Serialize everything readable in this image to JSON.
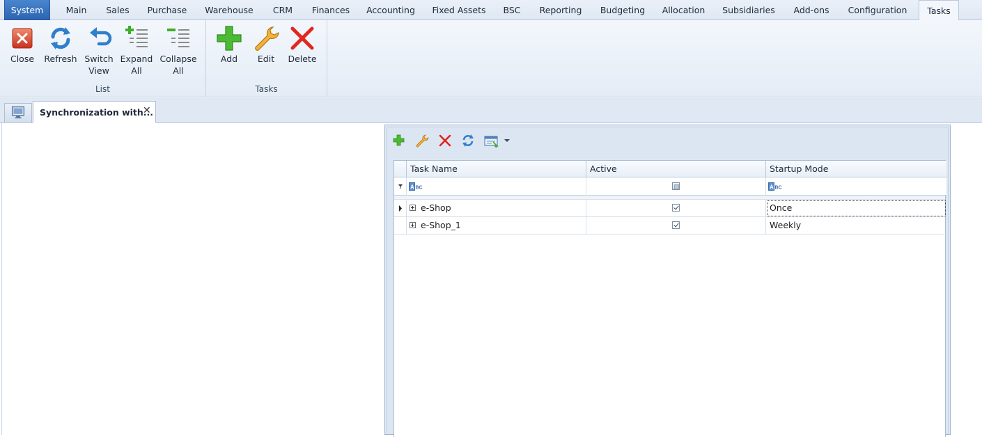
{
  "menu": {
    "tabs": [
      {
        "label": "System",
        "name": "menu-tab-system"
      },
      {
        "label": "Main",
        "name": "menu-tab-main"
      },
      {
        "label": "Sales",
        "name": "menu-tab-sales"
      },
      {
        "label": "Purchase",
        "name": "menu-tab-purchase"
      },
      {
        "label": "Warehouse",
        "name": "menu-tab-warehouse"
      },
      {
        "label": "CRM",
        "name": "menu-tab-crm"
      },
      {
        "label": "Finances",
        "name": "menu-tab-finances"
      },
      {
        "label": "Accounting",
        "name": "menu-tab-accounting"
      },
      {
        "label": "Fixed Assets",
        "name": "menu-tab-fixed-assets"
      },
      {
        "label": "BSC",
        "name": "menu-tab-bsc"
      },
      {
        "label": "Reporting",
        "name": "menu-tab-reporting"
      },
      {
        "label": "Budgeting",
        "name": "menu-tab-budgeting"
      },
      {
        "label": "Allocation",
        "name": "menu-tab-allocation"
      },
      {
        "label": "Subsidiaries",
        "name": "menu-tab-subsidiaries"
      },
      {
        "label": "Add-ons",
        "name": "menu-tab-add-ons"
      },
      {
        "label": "Configuration",
        "name": "menu-tab-configuration"
      },
      {
        "label": "Tasks",
        "name": "menu-tab-tasks"
      }
    ],
    "active_tab": "Tasks"
  },
  "ribbon": {
    "list_group": {
      "label": "List",
      "close": "Close",
      "refresh": "Refresh",
      "switch_view_1": "Switch",
      "switch_view_2": "View",
      "expand_all_1": "Expand",
      "expand_all_2": "All",
      "collapse_all_1": "Collapse",
      "collapse_all_2": "All"
    },
    "tasks_group": {
      "label": "Tasks",
      "add": "Add",
      "edit": "Edit",
      "delete": "Delete"
    }
  },
  "document_tab": {
    "title": "Synchronization with...",
    "close_glyph": "✕"
  },
  "grid": {
    "columns": [
      "Task Name",
      "Active",
      "Startup Mode"
    ],
    "rows": [
      {
        "task_name": "e-Shop",
        "active": true,
        "startup_mode": "Once"
      },
      {
        "task_name": "e-Shop_1",
        "active": true,
        "startup_mode": "Weekly"
      }
    ]
  },
  "icons": {
    "close": "close-icon",
    "refresh": "refresh-icon",
    "switch_view": "switch-view-icon",
    "expand_all": "expand-all-icon",
    "collapse_all": "collapse-all-icon",
    "add": "add-icon",
    "edit": "wrench-icon",
    "delete": "delete-icon"
  },
  "colors": {
    "accent_blue": "#2c64b1",
    "add_green": "#3fae2a",
    "delete_red": "#e0281e",
    "ribbon_bg": "#e4ecf6"
  }
}
